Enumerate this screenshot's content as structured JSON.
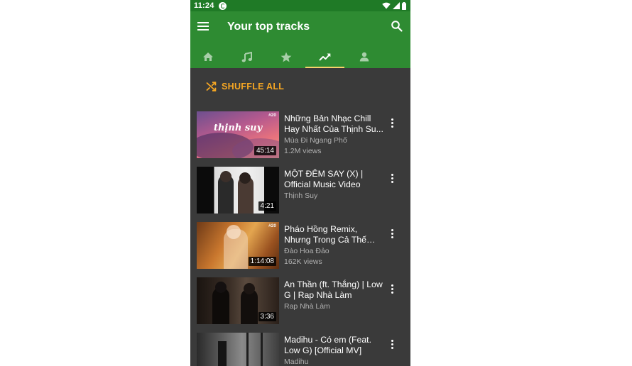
{
  "status": {
    "time": "11:24"
  },
  "toolbar": {
    "title": "Your top tracks"
  },
  "tabs": [
    {
      "icon": "home-icon",
      "active": false
    },
    {
      "icon": "music-note-icon",
      "active": false
    },
    {
      "icon": "star-icon",
      "active": false
    },
    {
      "icon": "trending-icon",
      "active": true
    },
    {
      "icon": "person-icon",
      "active": false
    }
  ],
  "shuffle": {
    "label": "SHUFFLE ALL"
  },
  "tracks": [
    {
      "title": "Những Bản Nhạc Chill Hay Nhất Của Thịnh Su...",
      "channel": "Mùa Đi Ngang Phố",
      "views": "1.2M views",
      "duration": "45:14",
      "thumb_text": "thịnh suy",
      "badge": "#20"
    },
    {
      "title": "MỘT ĐÊM SAY (X) | Official Music Video",
      "channel": "Thịnh Suy",
      "views": "",
      "duration": "4:21",
      "thumb_text": "",
      "badge": ""
    },
    {
      "title": "Pháo Hồng Remix, Nhưng Trong Cả Thế Gi...",
      "channel": "Đào Hoa Đảo",
      "views": "162K views",
      "duration": "1:14:08",
      "thumb_text": "",
      "badge": "#20"
    },
    {
      "title": "An Thần (ft. Thắng) | Low G | Rap Nhà Làm",
      "channel": "Rap Nhà Làm",
      "views": "",
      "duration": "3:36",
      "thumb_text": "",
      "badge": ""
    },
    {
      "title": "Madihu - Có em (Feat. Low G) [Official MV]",
      "channel": "Madihu",
      "views": "",
      "duration": "",
      "thumb_text": "",
      "badge": ""
    }
  ],
  "colors": {
    "status_bar": "#1f7a26",
    "toolbar": "#2e8b32",
    "background": "#3a3a3a",
    "accent": "#f5a623",
    "tab_indicator": "#f5d36b"
  }
}
